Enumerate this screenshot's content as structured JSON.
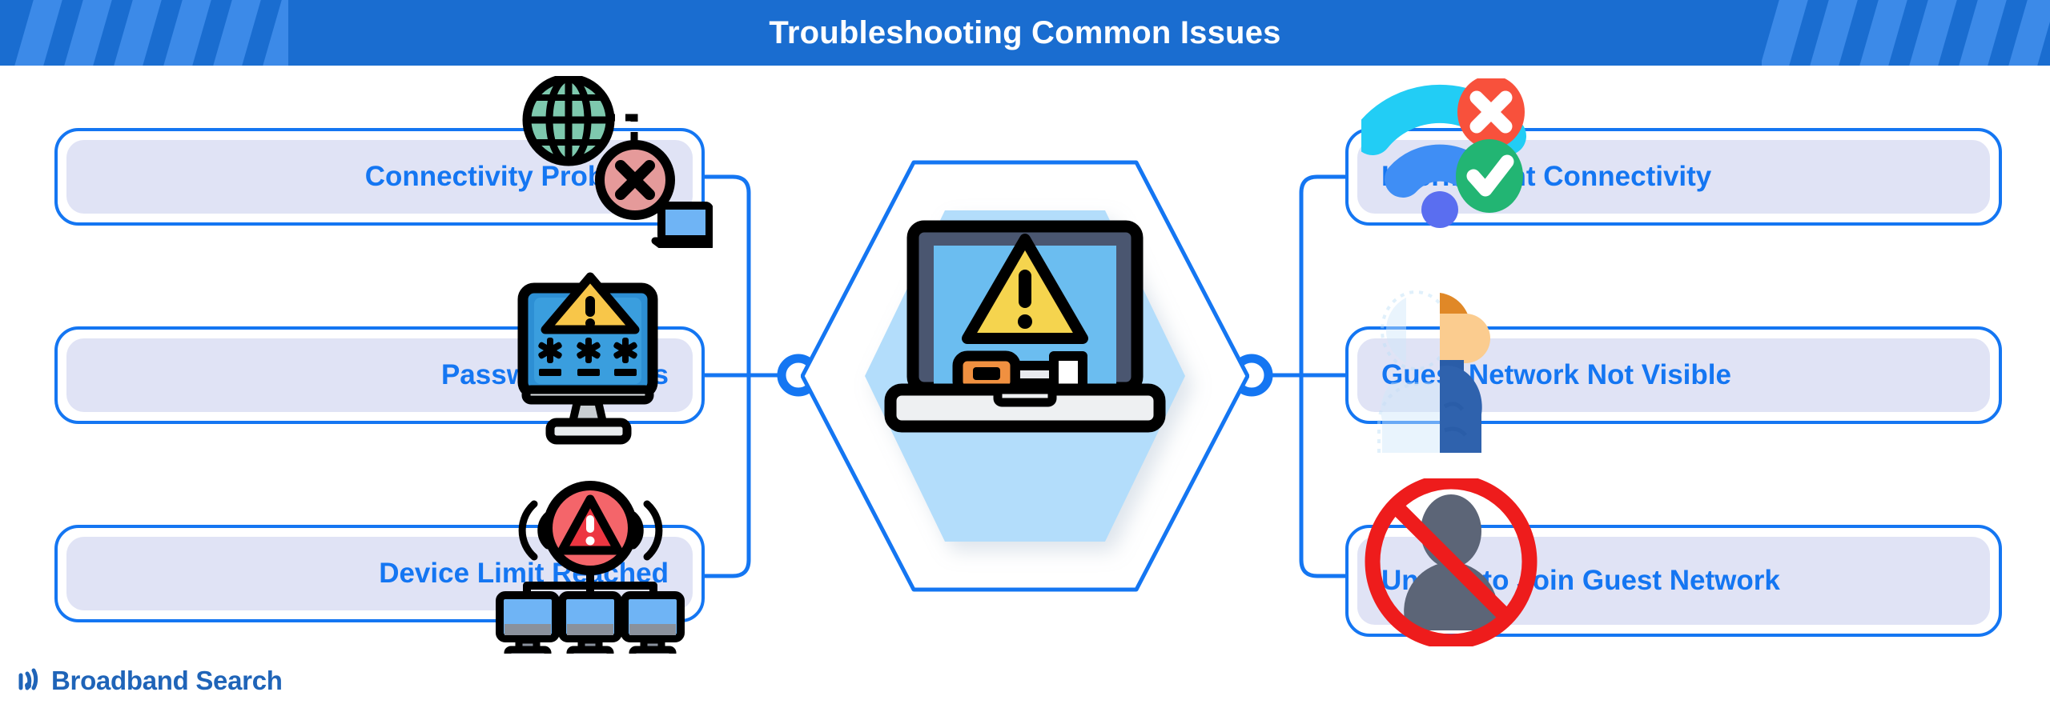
{
  "header": {
    "title": "Troubleshooting Common Issues",
    "bg_color": "#1a6dd0",
    "stripe_color": "#3c8ae8",
    "title_color": "#ffffff"
  },
  "theme": {
    "accent_blue": "#1476f2",
    "card_fill": "#e0e3f5",
    "label_color": "#1476f2",
    "hex_fill": "#b3ddfb",
    "logo_color": "#1f64b8"
  },
  "left_column": [
    {
      "id": "connectivity-problems",
      "label": "Connectivity Problems",
      "icon": "globe-error-laptop-icon"
    },
    {
      "id": "password-issues",
      "label": "Password Issues",
      "icon": "monitor-password-warning-icon"
    },
    {
      "id": "device-limit-reached",
      "label": "Device Limit Reached",
      "icon": "devices-alert-icon"
    }
  ],
  "right_column": [
    {
      "id": "intermittent-connectivity",
      "label": "Intermittent Connectivity",
      "icon": "wifi-check-cross-icon"
    },
    {
      "id": "guest-network-not-visible",
      "label": "Guest Network Not Visible",
      "icon": "half-visible-person-icon"
    },
    {
      "id": "unable-to-join-guest-network",
      "label": "Unable to Join Guest Network",
      "icon": "person-prohibited-icon"
    }
  ],
  "center": {
    "icon": "laptop-troubleshooting-icon",
    "shape": "hexagon"
  },
  "logo": {
    "text": "Broadband Search",
    "icon": "wifi-signal-icon"
  }
}
